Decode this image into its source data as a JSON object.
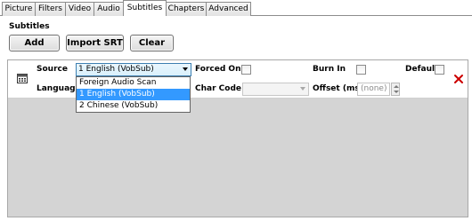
{
  "tabs": [
    "Picture",
    "Filters",
    "Video",
    "Audio",
    "Subtitles",
    "Chapters",
    "Advanced"
  ],
  "active_tab": "Subtitles",
  "section_title": "Subtitles",
  "buttons": {
    "add": "Add",
    "import_srt": "Import SRT",
    "clear": "Clear"
  },
  "track": {
    "source_label": "Source",
    "source_value": "1 English (VobSub)",
    "forced_only_label": "Forced Only",
    "burn_in_label": "Burn In",
    "default_label": "Default",
    "language_label": "Language",
    "char_code_label": "Char Code",
    "char_code_value": "",
    "offset_label": "Offset (ms)",
    "offset_value": "(none)"
  },
  "dropdown_options": [
    "Foreign Audio Scan",
    "1 English (VobSub)",
    "2 Chinese (VobSub)"
  ],
  "dropdown_selected_index": 1,
  "colors": {
    "selection": "#3399ff",
    "delete": "#cc0000"
  }
}
